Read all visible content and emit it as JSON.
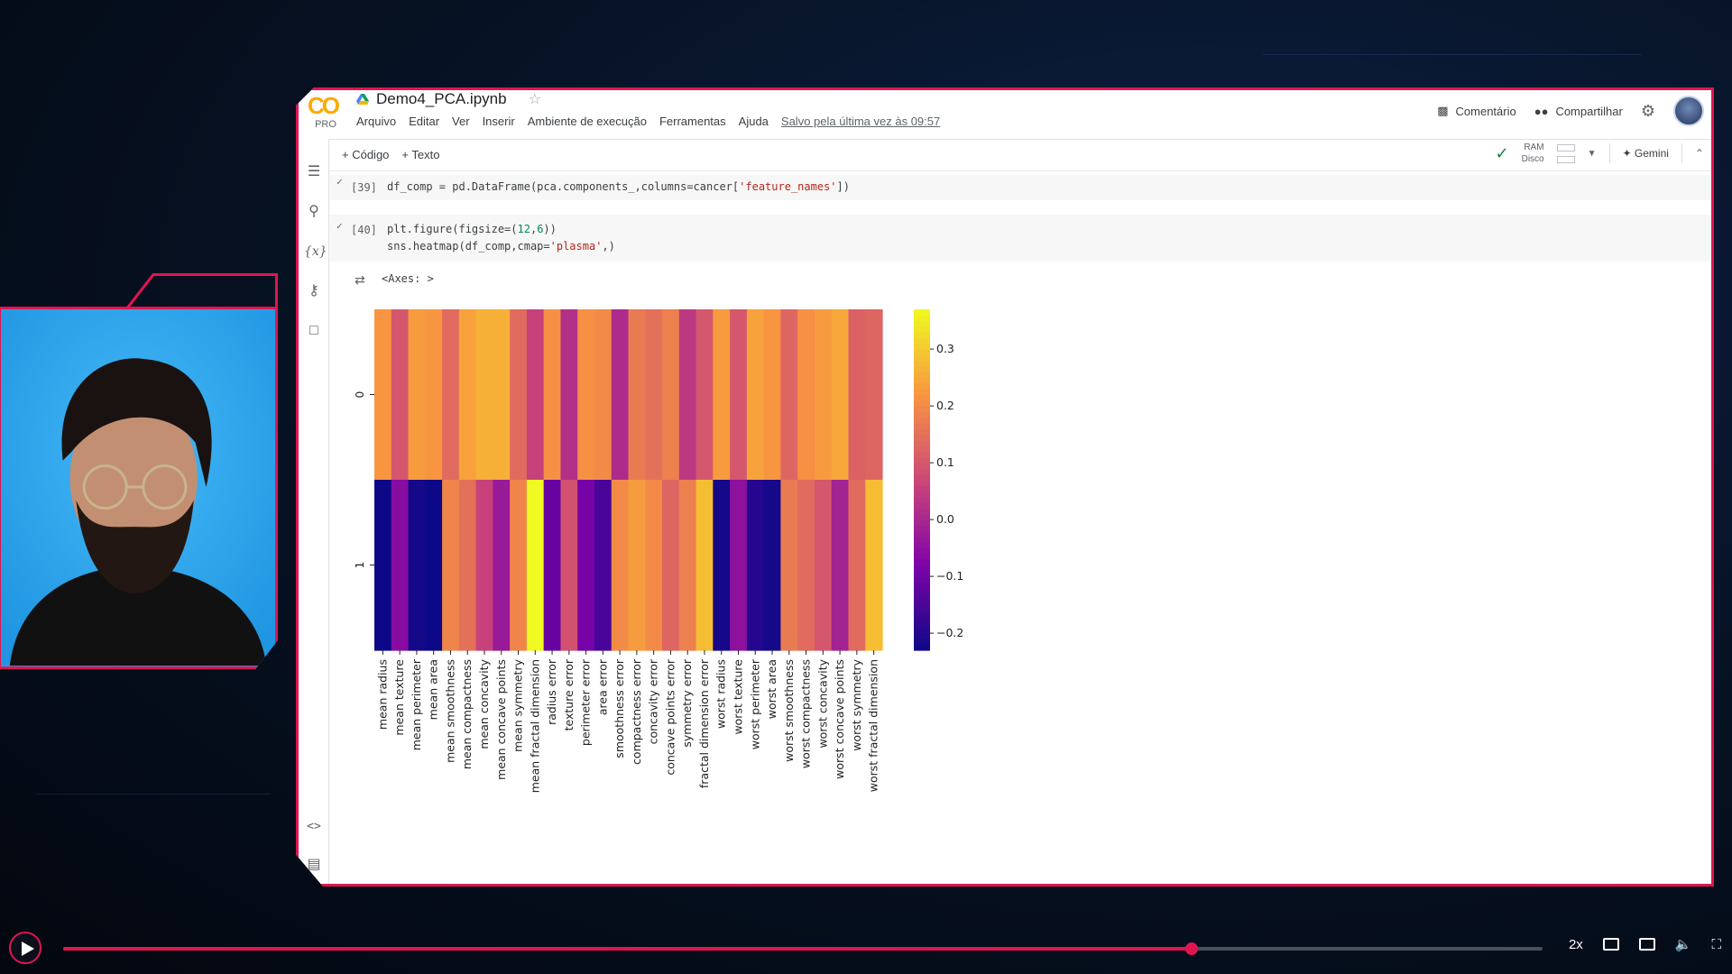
{
  "notebook": {
    "title": "Demo4_PCA.ipynb",
    "logo_text": "CO",
    "pro_label": "PRO",
    "menu": [
      "Arquivo",
      "Editar",
      "Ver",
      "Inserir",
      "Ambiente de execução",
      "Ferramentas",
      "Ajuda"
    ],
    "saved_text": "Salvo pela última vez às 09:57",
    "comment_label": "Comentário",
    "share_label": "Compartilhar",
    "toolbar": {
      "code_label": "+ Código",
      "text_label": "+ Texto",
      "ram_label": "RAM",
      "disk_label": "Disco",
      "gemini_label": "Gemini"
    },
    "cells": [
      {
        "number": "[39]",
        "line1": "df_comp = pd.DataFrame(pca.components_,columns=cancer[",
        "str1": "'feature_names'",
        "end1": "])"
      },
      {
        "number": "[40]",
        "line1a": "plt.figure(figsize=(",
        "n1": "12",
        "c1": ",",
        "n2": "6",
        "e1": "))",
        "line2a": "sns.heatmap(df_comp,cmap=",
        "str2": "'plasma'",
        "e2": ",)"
      }
    ],
    "output_text": "<Axes: >"
  },
  "player": {
    "speed_label": "2x",
    "progress": 0.763
  },
  "colors": {
    "accent": "#e01550",
    "colab_orange": "#f9ab00"
  },
  "chart_data": {
    "type": "heatmap",
    "colormap": "plasma",
    "rows": [
      "0",
      "1"
    ],
    "columns": [
      "mean radius",
      "mean texture",
      "mean perimeter",
      "mean area",
      "mean smoothness",
      "mean compactness",
      "mean concavity",
      "mean concave points",
      "mean symmetry",
      "mean fractal dimension",
      "radius error",
      "texture error",
      "perimeter error",
      "area error",
      "smoothness error",
      "compactness error",
      "concavity error",
      "concave points error",
      "symmetry error",
      "fractal dimension error",
      "worst radius",
      "worst texture",
      "worst perimeter",
      "worst area",
      "worst smoothness",
      "worst compactness",
      "worst concavity",
      "worst concave points",
      "worst symmetry",
      "worst fractal dimension"
    ],
    "values": [
      [
        0.22,
        0.1,
        0.23,
        0.22,
        0.14,
        0.24,
        0.26,
        0.26,
        0.14,
        0.06,
        0.21,
        0.02,
        0.21,
        0.2,
        0.01,
        0.17,
        0.15,
        0.18,
        0.04,
        0.1,
        0.23,
        0.1,
        0.24,
        0.22,
        0.13,
        0.21,
        0.23,
        0.25,
        0.12,
        0.13
      ],
      [
        -0.23,
        -0.06,
        -0.22,
        -0.23,
        0.19,
        0.15,
        0.06,
        -0.03,
        0.19,
        0.37,
        -0.11,
        0.09,
        -0.09,
        -0.15,
        0.2,
        0.23,
        0.2,
        0.13,
        0.18,
        0.28,
        -0.22,
        -0.05,
        -0.2,
        -0.22,
        0.17,
        0.14,
        0.1,
        -0.01,
        0.14,
        0.28
      ]
    ],
    "colorbar_ticks": [
      0.3,
      0.2,
      0.1,
      0.0,
      -0.1,
      -0.2
    ],
    "colorbar_labels": [
      "0.3",
      "0.2",
      "0.1",
      "0.0",
      "−0.1",
      "−0.2"
    ],
    "vlim": [
      -0.23,
      0.37
    ]
  }
}
